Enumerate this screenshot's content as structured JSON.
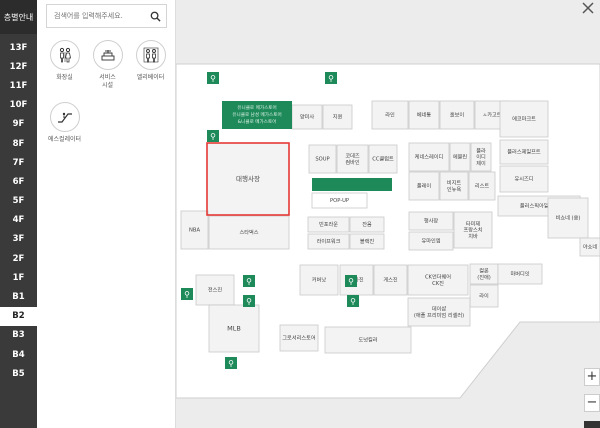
{
  "nav": {
    "title": "층별안내",
    "floors": [
      "13F",
      "12F",
      "11F",
      "10F",
      "9F",
      "8F",
      "7F",
      "6F",
      "5F",
      "4F",
      "3F",
      "2F",
      "1F",
      "B1",
      "B2",
      "B3",
      "B4",
      "B5"
    ],
    "active": "B2"
  },
  "search": {
    "placeholder": "검색어를 입력해주세요."
  },
  "facilities": [
    {
      "label": "화장실",
      "icon": "restroom-icon"
    },
    {
      "label": "서비스\n시설",
      "icon": "service-desk-icon"
    },
    {
      "label": "엘리베이터",
      "icon": "elevator-icon"
    },
    {
      "label": "에스컬레이터",
      "icon": "escalator-icon"
    }
  ],
  "map": {
    "highlight_color": "#e53935",
    "green": "#1e8a5a",
    "stores": [
      {
        "label": "양미사"
      },
      {
        "label": "지퀸"
      },
      {
        "label": "라인"
      },
      {
        "label": "베네통"
      },
      {
        "label": "홀보이"
      },
      {
        "label": "ㅅ카고트"
      },
      {
        "label": "에코마크트"
      },
      {
        "label": "대행사장"
      },
      {
        "label": "SOUP"
      },
      {
        "label": "코데즈\n컴바인"
      },
      {
        "label": "CC클럽트"
      },
      {
        "label": "케네스레이디"
      },
      {
        "label": "에블린"
      },
      {
        "label": "플라\n이디\n제이"
      },
      {
        "label": "폴레이"
      },
      {
        "label": "비지트\n인뉴욕"
      },
      {
        "label": "리스트"
      },
      {
        "label": "플러스제일프트"
      },
      {
        "label": "유시즈디"
      },
      {
        "label": "플러스픽아일랜드"
      },
      {
        "label": "비쇼네 (쏭)"
      },
      {
        "label": "야쇼네"
      },
      {
        "label": "POP-UP"
      },
      {
        "label": "NBA"
      },
      {
        "label": "스타벅스"
      },
      {
        "label": "빈포라운"
      },
      {
        "label": "잔움"
      },
      {
        "label": "라이프워크"
      },
      {
        "label": "블랙진"
      },
      {
        "label": "행사장"
      },
      {
        "label": "타미제\n프랑스치\n치바"
      },
      {
        "label": "유마인엠"
      },
      {
        "label": "커버낫"
      },
      {
        "label": "디아진"
      },
      {
        "label": "게스진"
      },
      {
        "label": "CK언더웨어\nCK진"
      },
      {
        "label": "컬론\n(진애)"
      },
      {
        "label": "마버디잇"
      },
      {
        "label": "라이"
      },
      {
        "label": "데이샵\n(애플 프리미엄 리셀러)"
      },
      {
        "label": "전스진"
      },
      {
        "label": "MLB"
      },
      {
        "label": "그로서리스토어"
      },
      {
        "label": "도넛킬러"
      }
    ],
    "green_block_text": "유니클로  메가스토어\n유니클로 남성 메가스토어\n&니클로 메가스토어"
  },
  "controls": {
    "zoom_in": "+",
    "zoom_out": "−"
  }
}
